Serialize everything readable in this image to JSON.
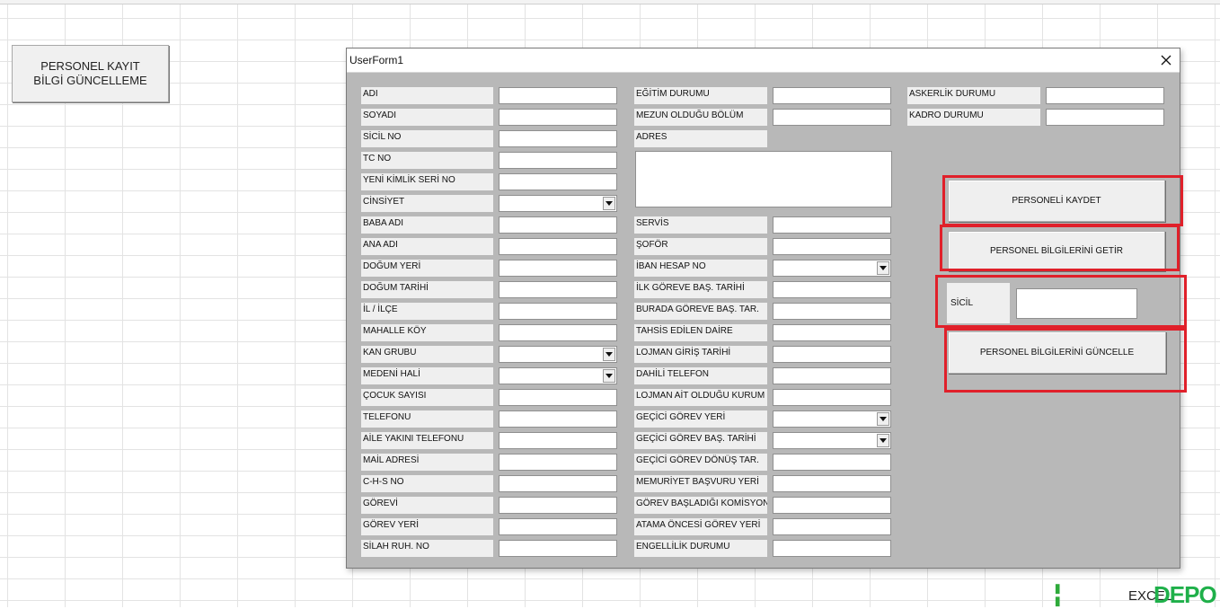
{
  "sheet_button": {
    "line1": "PERSONEL KAYIT",
    "line2": "BİLGİ GÜNCELLEME"
  },
  "window": {
    "title": "UserForm1"
  },
  "col1": [
    {
      "label": "ADI",
      "type": "text"
    },
    {
      "label": "SOYADI",
      "type": "text"
    },
    {
      "label": "SİCİL NO",
      "type": "text"
    },
    {
      "label": "TC NO",
      "type": "text"
    },
    {
      "label": "YENİ KİMLİK SERİ NO",
      "type": "text"
    },
    {
      "label": "CİNSİYET",
      "type": "combo"
    },
    {
      "label": "BABA ADI",
      "type": "text"
    },
    {
      "label": "ANA ADI",
      "type": "text"
    },
    {
      "label": "DOĞUM YERİ",
      "type": "text"
    },
    {
      "label": "DOĞUM TARİHİ",
      "type": "text"
    },
    {
      "label": "İL / İLÇE",
      "type": "text"
    },
    {
      "label": "MAHALLE KÖY",
      "type": "text"
    },
    {
      "label": "KAN GRUBU",
      "type": "combo"
    },
    {
      "label": "MEDENİ HALİ",
      "type": "combo"
    },
    {
      "label": "ÇOCUK SAYISI",
      "type": "text"
    },
    {
      "label": "TELEFONU",
      "type": "text"
    },
    {
      "label": "AİLE YAKINI TELEFONU",
      "type": "text"
    },
    {
      "label": "MAİL ADRESİ",
      "type": "text"
    },
    {
      "label": "C-H-S NO",
      "type": "text"
    },
    {
      "label": "GÖREVİ",
      "type": "text"
    },
    {
      "label": "GÖREV YERİ",
      "type": "text"
    },
    {
      "label": "SİLAH RUH. NO",
      "type": "text"
    }
  ],
  "col2_top": [
    {
      "label": "EĞİTİM DURUMU",
      "type": "text"
    },
    {
      "label": "MEZUN OLDUĞU BÖLÜM",
      "type": "text"
    }
  ],
  "adres_label": "ADRES",
  "col2": [
    {
      "label": "SERVİS",
      "type": "text"
    },
    {
      "label": "ŞOFÖR",
      "type": "text"
    },
    {
      "label": "İBAN HESAP NO",
      "type": "combo"
    },
    {
      "label": "İLK GÖREVE BAŞ. TARİHİ",
      "type": "text"
    },
    {
      "label": "BURADA GÖREVE BAŞ. TAR.",
      "type": "text"
    },
    {
      "label": "TAHSİS EDİLEN DAİRE",
      "type": "text"
    },
    {
      "label": "LOJMAN GİRİŞ TARİHİ",
      "type": "text"
    },
    {
      "label": "DAHİLİ TELEFON",
      "type": "text"
    },
    {
      "label": "LOJMAN AİT OLDUĞU KURUM",
      "type": "text"
    },
    {
      "label": "GEÇİCİ GÖREV YERİ",
      "type": "combo"
    },
    {
      "label": "GEÇİCİ GÖREV BAŞ. TARİHİ",
      "type": "combo"
    },
    {
      "label": "GEÇİCİ GÖREV DÖNÜŞ TAR.",
      "type": "text"
    },
    {
      "label": "MEMURİYET BAŞVURU YERİ",
      "type": "text"
    },
    {
      "label": "GÖREV BAŞLADIĞI KOMİSYON",
      "type": "text"
    },
    {
      "label": "ATAMA ÖNCESİ GÖREV YERİ",
      "type": "text"
    },
    {
      "label": "ENGELLİLİK DURUMU",
      "type": "text"
    }
  ],
  "col3": [
    {
      "label": "ASKERLİK DURUMU",
      "type": "text"
    },
    {
      "label": "KADRO DURUMU",
      "type": "text"
    }
  ],
  "buttons": {
    "save": "PERSONELİ KAYDET",
    "fetch": "PERSONEL BİLGİLERİNİ GETİR",
    "update": "PERSONEL BİLGİLERİNİ GÜNCELLE"
  },
  "sicil_label": "SİCİL",
  "watermark": {
    "text": "EXCEL",
    "logo": "DEPO"
  },
  "colors": {
    "highlight": "#e0202a",
    "form_bg": "#b8b8b8",
    "logo_green": "#1fb04a"
  }
}
